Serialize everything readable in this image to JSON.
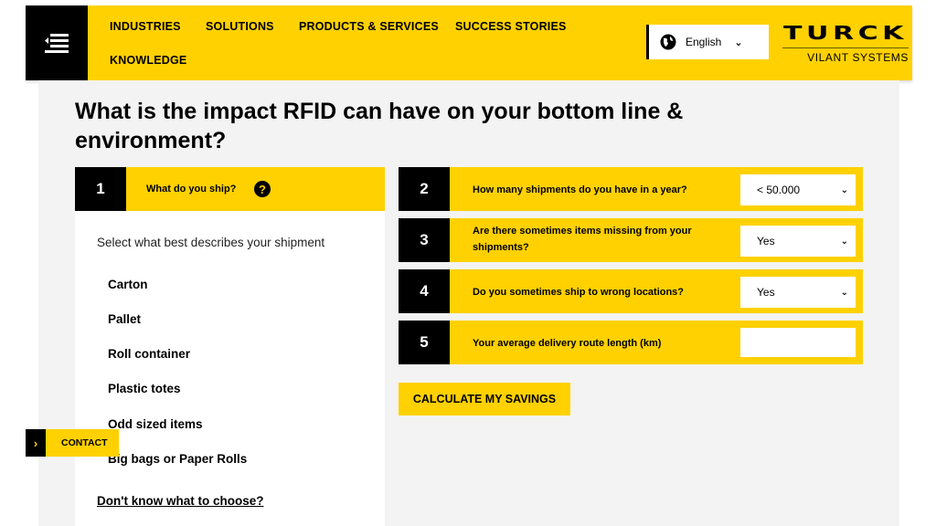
{
  "header": {
    "nav": [
      "INDUSTRIES",
      "SOLUTIONS",
      "PRODUCTS & SERVICES",
      "SUCCESS STORIES",
      "KNOWLEDGE"
    ],
    "language": "English",
    "logo_text": "TURCK",
    "logo_sub": "VILANT SYSTEMS"
  },
  "page": {
    "title": "What is the impact RFID can have on your bottom line & environment?"
  },
  "step1": {
    "number": "1",
    "question": "What do you ship?",
    "instruction": "Select what best describes your shipment",
    "options": [
      "Carton",
      "Pallet",
      "Roll container",
      "Plastic totes",
      "Odd sized items",
      "Big bags or Paper Rolls"
    ],
    "dont_know": "Don't know what to choose?"
  },
  "steps": [
    {
      "number": "2",
      "question": "How many shipments do you have in a year?",
      "value": "< 50.000"
    },
    {
      "number": "3",
      "question": "Are there sometimes items missing from your shipments?",
      "value": "Yes"
    },
    {
      "number": "4",
      "question": "Do you sometimes ship to wrong locations?",
      "value": "Yes"
    },
    {
      "number": "5",
      "question": "Your average delivery route length (km)",
      "value": ""
    }
  ],
  "calculate_label": "CALCULATE MY SAVINGS",
  "contact_label": "CONTACT",
  "colors": {
    "brand_yellow": "#ffd100",
    "black": "#000000"
  }
}
